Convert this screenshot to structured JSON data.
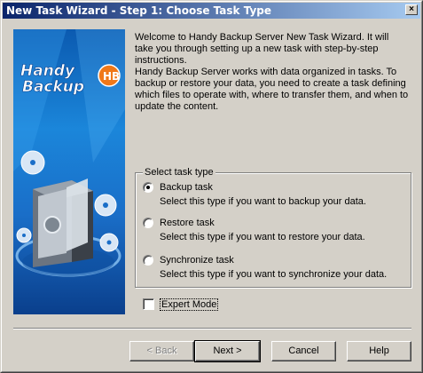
{
  "window": {
    "title": "New Task Wizard - Step 1: Choose Task Type",
    "close_glyph": "×"
  },
  "banner": {
    "logo_line1": "Handy",
    "logo_line2": "Backup"
  },
  "intro": {
    "paragraph1": "Welcome to Handy Backup Server New Task Wizard. It will take you through setting up a new task with step-by-step instructions.",
    "paragraph2": "Handy Backup Server works with data organized in tasks. To backup or restore your data, you need to create a task defining which files to operate with, where to transfer them, and when to update the content."
  },
  "task_type": {
    "legend": "Select task type",
    "options": [
      {
        "label": "Backup task",
        "description": "Select this type if you want to backup your data.",
        "selected": true
      },
      {
        "label": "Restore task",
        "description": "Select this type if you want to restore your data.",
        "selected": false
      },
      {
        "label": "Synchronize task",
        "description": "Select this type if you want to synchronize your data.",
        "selected": false
      }
    ]
  },
  "expert_mode": {
    "label": "Expert Mode",
    "checked": false
  },
  "buttons": {
    "back": "< Back",
    "next": "Next >",
    "cancel": "Cancel",
    "help": "Help"
  }
}
